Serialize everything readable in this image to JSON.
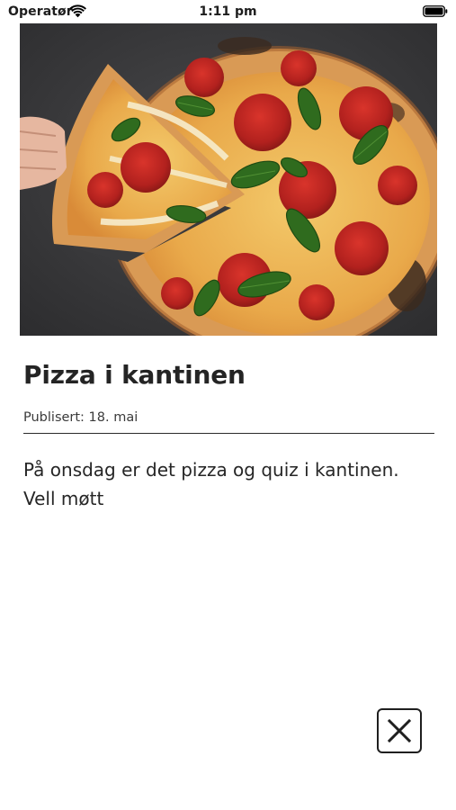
{
  "status_bar": {
    "carrier": "Operatør",
    "time": "1:11 pm",
    "wifi_icon": "wifi-icon",
    "battery_icon": "battery-icon"
  },
  "hero_image": {
    "subject": "pizza photo"
  },
  "article": {
    "title": "Pizza i kantinen",
    "published": "Publisert: 18. mai",
    "body": "På onsdag er det pizza og quiz i kantinen. Vell møtt"
  },
  "close_button": {
    "icon": "close-icon"
  },
  "colors": {
    "background": "#ffffff",
    "text": "#242424",
    "divider": "#2b2b2b"
  }
}
